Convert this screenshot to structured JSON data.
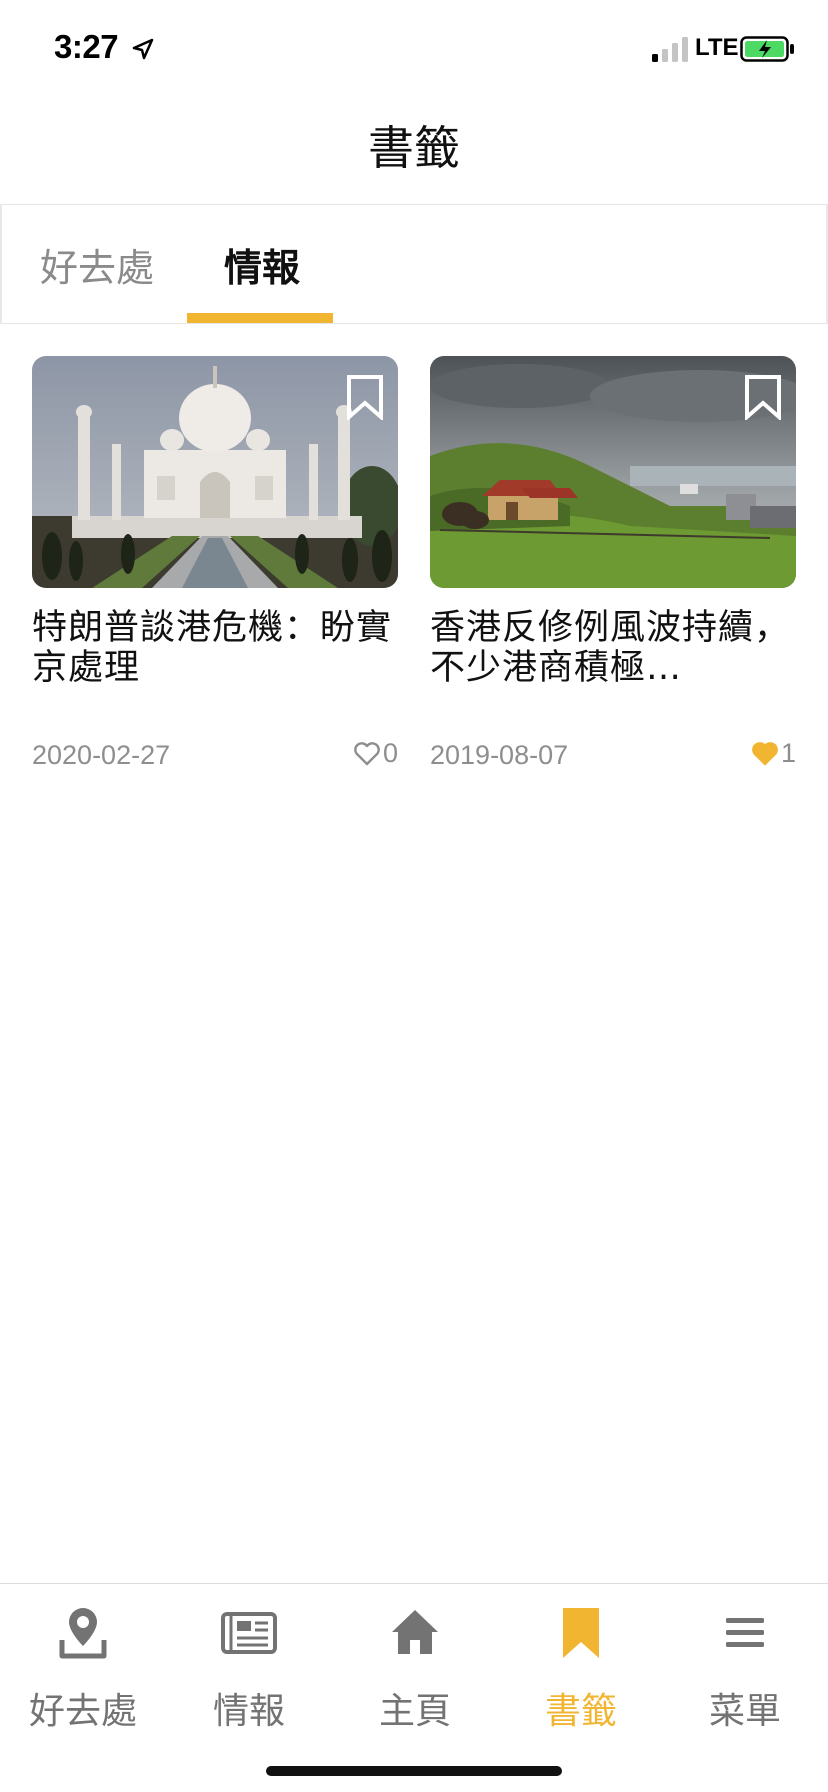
{
  "status_bar": {
    "time": "3:27",
    "carrier": "LTE",
    "icons": [
      "location-arrow-icon",
      "signal-icon",
      "battery-charging-icon"
    ]
  },
  "header": {
    "title": "書籤"
  },
  "tabs": [
    {
      "label": "好去處",
      "active": false
    },
    {
      "label": "情報",
      "active": true
    }
  ],
  "cards": [
    {
      "title": "特朗普談港危機：盼實京處理",
      "date": "2020-02-27",
      "likes": "0",
      "liked": false,
      "image": "taj-mahal-photo"
    },
    {
      "title": "香港反修例風波持續，不少港商積極…",
      "date": "2019-08-07",
      "likes": "1",
      "liked": true,
      "image": "green-hillside-farm-photo"
    }
  ],
  "bottom_nav": [
    {
      "label": "好去處",
      "icon": "location-pin-icon",
      "active": false
    },
    {
      "label": "情報",
      "icon": "newspaper-icon",
      "active": false
    },
    {
      "label": "主頁",
      "icon": "home-icon",
      "active": false
    },
    {
      "label": "書籤",
      "icon": "bookmark-icon",
      "active": true
    },
    {
      "label": "菜單",
      "icon": "menu-icon",
      "active": false
    }
  ],
  "colors": {
    "accent": "#f2b531",
    "inactive": "#737373",
    "secondary_text": "#8e8e8e"
  }
}
